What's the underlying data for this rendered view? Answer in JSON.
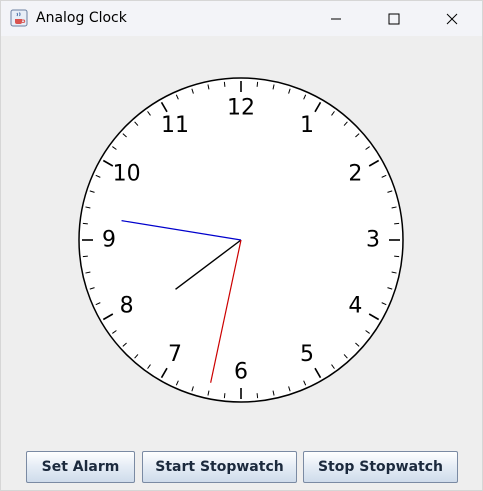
{
  "window": {
    "title": "Analog Clock",
    "app_icon": "java-coffee-icon",
    "controls": {
      "minimize_icon": "minimize-icon",
      "maximize_icon": "maximize-icon",
      "close_icon": "close-icon"
    }
  },
  "clock": {
    "numerals": [
      "12",
      "1",
      "2",
      "3",
      "4",
      "5",
      "6",
      "7",
      "8",
      "9",
      "10",
      "11"
    ],
    "time": {
      "hour": 7,
      "minute": 46,
      "second": 32
    },
    "colors": {
      "face": "#ffffff",
      "rim": "#000000",
      "hour_hand": "#000000",
      "minute_hand": "#0000cc",
      "second_hand": "#cc0000",
      "ticks": "#000000"
    }
  },
  "buttons": {
    "set_alarm": "Set Alarm",
    "start_stopwatch": "Start Stopwatch",
    "stop_stopwatch": "Stop Stopwatch"
  }
}
